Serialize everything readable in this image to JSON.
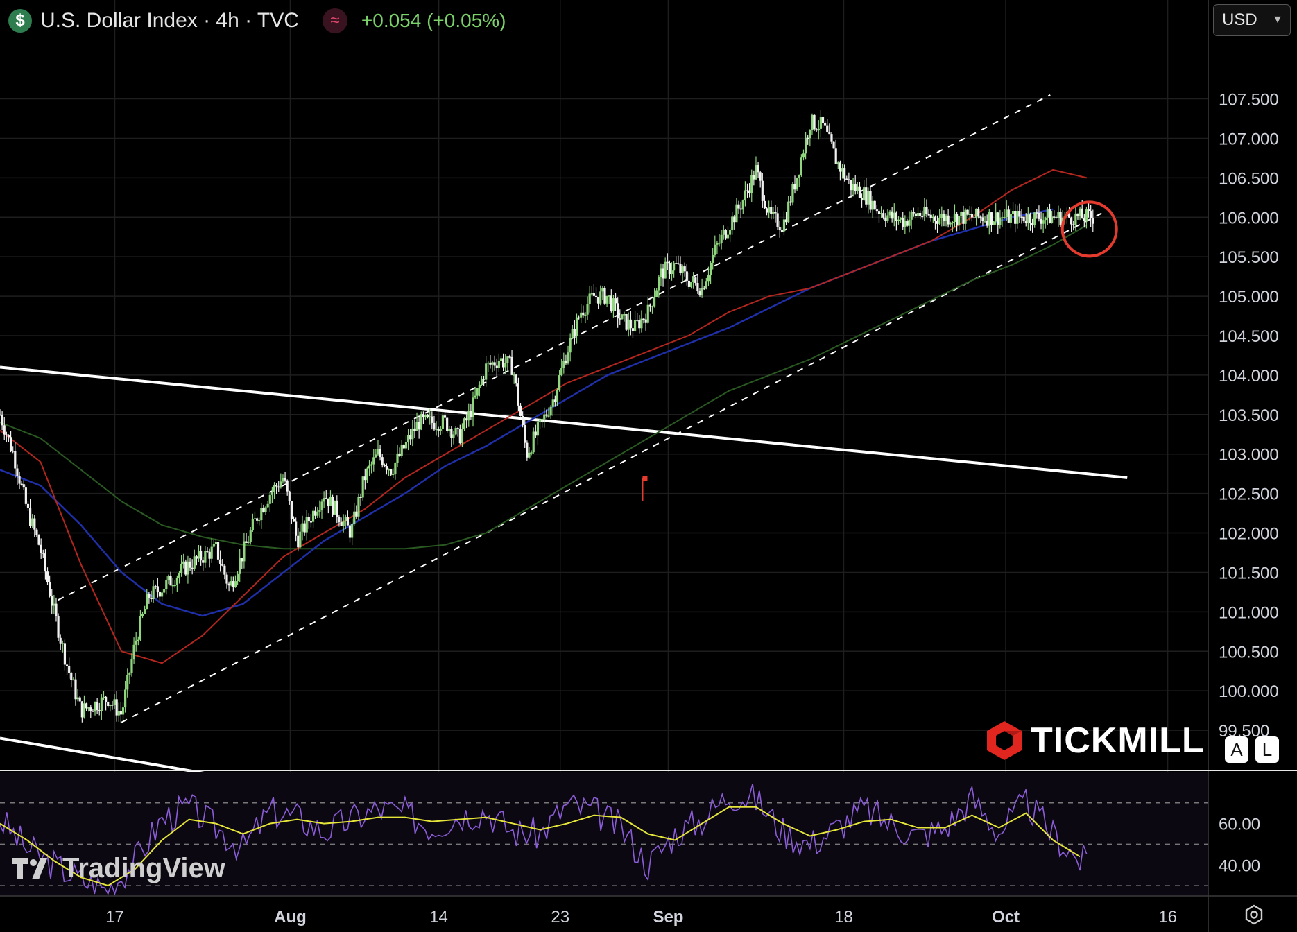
{
  "header": {
    "currency_icon": "dollar-icon",
    "symbol_title": "U.S. Dollar Index · 4h · TVC",
    "indicator_icon": "wave-icon",
    "change": "+0.054 (+0.05%)"
  },
  "currency_selector": {
    "value": "USD",
    "icon": "chevron-down-icon"
  },
  "axis_buttons": {
    "auto": "A",
    "log": "L"
  },
  "brands": {
    "tickmill": "TICKMILL",
    "tradingview": "TradingView"
  },
  "colors": {
    "bull": "#8fd67e",
    "bear": "#f2f2f2",
    "ma_fast": "#b3261e",
    "ma_mid": "#1f2fa8",
    "ma_slow": "#2a5a22",
    "trend": "#ffffff",
    "rsi": "#8a5cd6",
    "rsi_ma": "#e6e63a",
    "marker": "#e53b2f"
  },
  "chart_data": [
    {
      "type": "line",
      "title": "U.S. Dollar Index · 4h · TVC",
      "x_ticks": [
        {
          "label": "17",
          "t": 8.5
        },
        {
          "label": "Aug",
          "t": 21.5
        },
        {
          "label": "14",
          "t": 32.5
        },
        {
          "label": "23",
          "t": 41.5
        },
        {
          "label": "Sep",
          "t": 49.5
        },
        {
          "label": "18",
          "t": 62.5
        },
        {
          "label": "Oct",
          "t": 74.5
        },
        {
          "label": "16",
          "t": 86.5
        }
      ],
      "x_range": [
        0,
        89.5
      ],
      "y_ticks": [
        "107.500",
        "107.000",
        "106.500",
        "106.000",
        "105.500",
        "105.000",
        "104.500",
        "104.000",
        "103.500",
        "103.000",
        "102.500",
        "102.000",
        "101.500",
        "101.000",
        "100.500",
        "100.000",
        "99.500"
      ],
      "ylim": [
        99.0,
        107.9
      ],
      "price": {
        "t": [
          0,
          1,
          2,
          3,
          4,
          5,
          6,
          8,
          9,
          10,
          11,
          12,
          14,
          16,
          17,
          19,
          20,
          21,
          22,
          24,
          26,
          27,
          28,
          29,
          30,
          31,
          33,
          34,
          35,
          36,
          37,
          38,
          39,
          41,
          42,
          43,
          44,
          45,
          46,
          47,
          48,
          49,
          50,
          51,
          52,
          53,
          54,
          55,
          56,
          57,
          58,
          59,
          60,
          61,
          62,
          63,
          64,
          65,
          66,
          67,
          68,
          69,
          70,
          71,
          72,
          73,
          74,
          75,
          76,
          77,
          78,
          79,
          80,
          81,
          82
        ],
        "close": [
          103.5,
          103.0,
          102.3,
          101.8,
          101.0,
          100.3,
          99.75,
          99.9,
          99.7,
          100.6,
          101.2,
          101.3,
          101.6,
          101.8,
          101.3,
          102.2,
          102.5,
          102.7,
          101.9,
          102.5,
          102.0,
          102.7,
          103.0,
          102.8,
          103.1,
          103.4,
          103.4,
          103.2,
          103.6,
          104.1,
          104.2,
          104.1,
          103.0,
          103.7,
          104.3,
          104.8,
          105.0,
          105.0,
          104.7,
          104.6,
          104.8,
          105.3,
          105.4,
          105.2,
          105.1,
          105.6,
          105.9,
          106.2,
          106.6,
          106.0,
          105.9,
          106.5,
          107.2,
          107.15,
          106.7,
          106.4,
          106.3,
          106.1,
          106.0,
          105.95,
          106.05,
          106.0,
          106.0,
          106.0,
          106.0,
          106.0,
          106.0,
          106.0,
          106.0,
          106.0,
          106.0,
          106.0,
          106.0,
          106.0,
          106.0
        ]
      },
      "ma_fast": {
        "t": [
          0,
          3,
          6,
          9,
          12,
          15,
          18,
          21,
          24,
          27,
          30,
          33,
          36,
          39,
          42,
          45,
          48,
          51,
          54,
          57,
          60,
          63,
          66,
          69,
          72,
          75,
          78,
          80.5
        ],
        "v": [
          103.3,
          102.9,
          101.6,
          100.5,
          100.35,
          100.7,
          101.2,
          101.7,
          102.0,
          102.3,
          102.7,
          103.0,
          103.3,
          103.6,
          103.9,
          104.1,
          104.3,
          104.5,
          104.8,
          105.0,
          105.1,
          105.3,
          105.5,
          105.7,
          106.0,
          106.35,
          106.6,
          106.5
        ]
      },
      "ma_mid": {
        "t": [
          0,
          3,
          6,
          9,
          12,
          15,
          18,
          21,
          24,
          27,
          30,
          33,
          36,
          39,
          42,
          45,
          48,
          51,
          54,
          57,
          60,
          63,
          66,
          69,
          72,
          75,
          78
        ],
        "v": [
          102.8,
          102.6,
          102.1,
          101.5,
          101.1,
          100.95,
          101.1,
          101.5,
          101.9,
          102.2,
          102.5,
          102.85,
          103.1,
          103.4,
          103.7,
          104.0,
          104.2,
          104.4,
          104.6,
          104.85,
          105.1,
          105.3,
          105.5,
          105.7,
          105.85,
          106.0,
          106.1
        ]
      },
      "ma_slow": {
        "t": [
          0,
          3,
          6,
          9,
          12,
          15,
          18,
          21,
          24,
          27,
          30,
          33,
          36,
          39,
          42,
          45,
          48,
          51,
          54,
          57,
          60,
          63,
          66,
          69,
          72,
          75,
          78,
          80.5
        ],
        "v": [
          103.4,
          103.2,
          102.8,
          102.4,
          102.1,
          101.95,
          101.85,
          101.8,
          101.8,
          101.8,
          101.8,
          101.85,
          102.0,
          102.3,
          102.6,
          102.9,
          103.2,
          103.5,
          103.8,
          104.0,
          104.2,
          104.45,
          104.7,
          104.95,
          105.2,
          105.4,
          105.65,
          105.9
        ]
      }
    },
    {
      "type": "line",
      "y_ticks": [
        "60.00",
        "40.00"
      ],
      "ylim": [
        25,
        85
      ],
      "rsi": {
        "t": [
          0,
          2,
          4,
          6,
          8,
          9,
          10,
          12,
          14,
          16,
          18,
          20,
          22,
          24,
          26,
          28,
          30,
          32,
          34,
          36,
          38,
          40,
          42,
          44,
          46,
          48,
          50,
          52,
          54,
          56,
          58,
          60,
          62,
          64,
          66,
          68,
          70,
          72,
          74,
          76,
          78,
          80
        ],
        "v": [
          62,
          48,
          40,
          33,
          28,
          35,
          42,
          62,
          68,
          58,
          48,
          66,
          63,
          56,
          62,
          67,
          65,
          58,
          64,
          66,
          56,
          55,
          69,
          66,
          58,
          40,
          55,
          62,
          74,
          72,
          56,
          50,
          58,
          67,
          60,
          54,
          58,
          72,
          56,
          70,
          55,
          42
        ]
      },
      "rsi_ma": {
        "t": [
          0,
          2,
          4,
          6,
          8,
          10,
          12,
          14,
          16,
          18,
          20,
          22,
          24,
          26,
          28,
          30,
          32,
          34,
          36,
          38,
          40,
          42,
          44,
          46,
          48,
          50,
          52,
          54,
          56,
          58,
          60,
          62,
          64,
          66,
          68,
          70,
          72,
          74,
          76,
          78,
          80
        ],
        "v": [
          60,
          52,
          42,
          34,
          30,
          38,
          52,
          62,
          60,
          55,
          60,
          62,
          60,
          61,
          63,
          63,
          61,
          62,
          63,
          60,
          57,
          60,
          64,
          63,
          55,
          52,
          60,
          68,
          68,
          60,
          54,
          57,
          61,
          62,
          58,
          58,
          64,
          58,
          65,
          52,
          44
        ]
      }
    }
  ]
}
